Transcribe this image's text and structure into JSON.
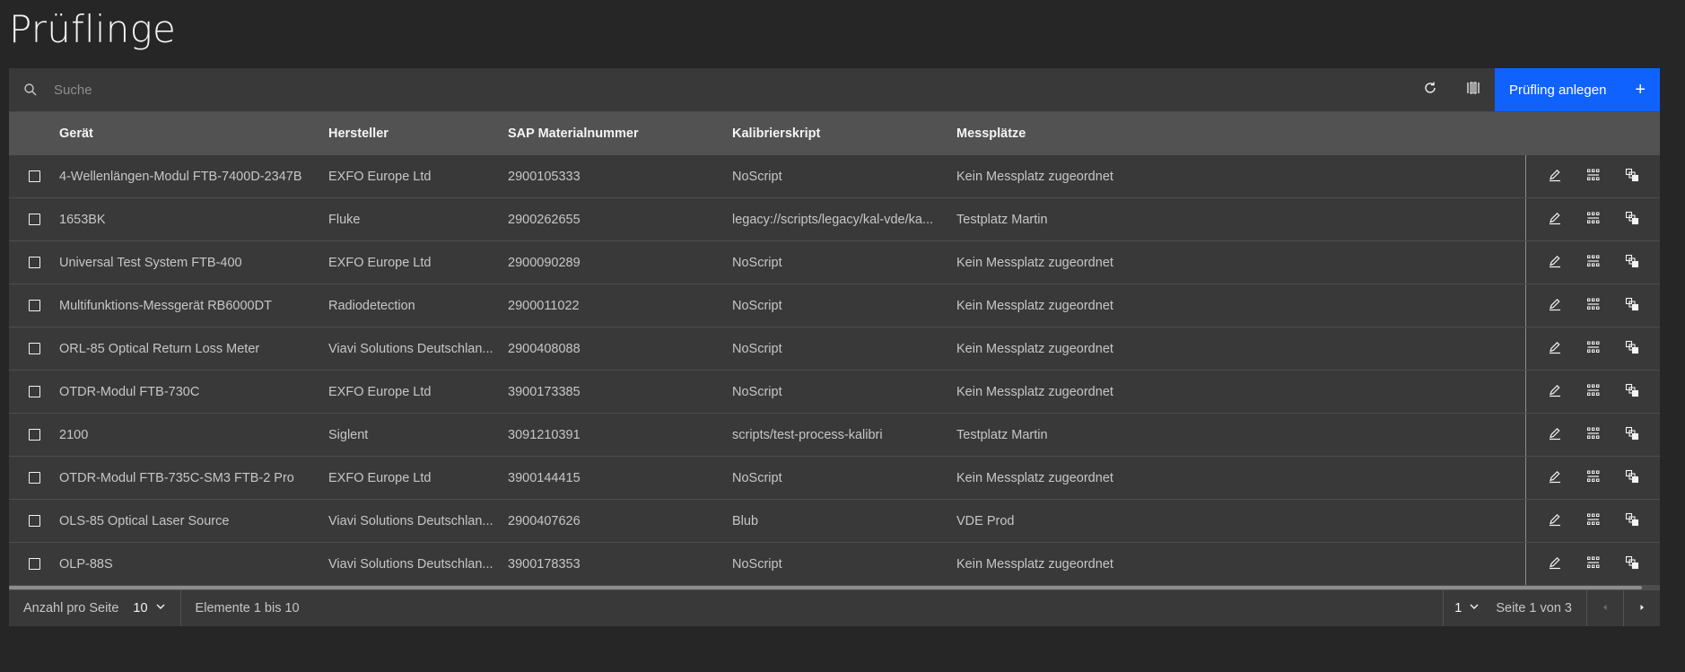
{
  "page": {
    "title": "Prüflinge"
  },
  "toolbar": {
    "search_placeholder": "Suche",
    "refresh_icon": "refresh-icon",
    "columns_icon": "column-settings-icon",
    "create_label": "Prüfling anlegen",
    "create_icon": "+"
  },
  "columns": {
    "geraet": "Gerät",
    "hersteller": "Hersteller",
    "sap": "SAP Materialnummer",
    "kalibrierskript": "Kalibrierskript",
    "messplaetze": "Messplätze"
  },
  "rows": [
    {
      "geraet": "4-Wellenlängen-Modul FTB-7400D-2347B",
      "hersteller": "EXFO Europe Ltd",
      "sap": "2900105333",
      "kalibrierskript": "NoScript",
      "messplaetze": "Kein Messplatz zugeordnet"
    },
    {
      "geraet": "1653BK",
      "hersteller": "Fluke",
      "sap": "2900262655",
      "kalibrierskript": "legacy://scripts/legacy/kal-vde/ka...",
      "messplaetze": "Testplatz Martin"
    },
    {
      "geraet": "Universal Test System FTB-400",
      "hersteller": "EXFO Europe Ltd",
      "sap": "2900090289",
      "kalibrierskript": "NoScript",
      "messplaetze": "Kein Messplatz zugeordnet"
    },
    {
      "geraet": "Multifunktions-Messgerät RB6000DT",
      "hersteller": "Radiodetection",
      "sap": "2900011022",
      "kalibrierskript": "NoScript",
      "messplaetze": "Kein Messplatz zugeordnet"
    },
    {
      "geraet": "ORL-85 Optical Return Loss Meter",
      "hersteller": "Viavi Solutions Deutschlan...",
      "sap": "2900408088",
      "kalibrierskript": "NoScript",
      "messplaetze": "Kein Messplatz zugeordnet"
    },
    {
      "geraet": "OTDR-Modul FTB-730C",
      "hersteller": "EXFO Europe Ltd",
      "sap": "3900173385",
      "kalibrierskript": "NoScript",
      "messplaetze": "Kein Messplatz zugeordnet"
    },
    {
      "geraet": "2100",
      "hersteller": "Siglent",
      "sap": "3091210391",
      "kalibrierskript": "scripts/test-process-kalibri",
      "messplaetze": "Testplatz Martin"
    },
    {
      "geraet": "OTDR-Modul FTB-735C-SM3 FTB-2 Pro",
      "hersteller": "EXFO Europe Ltd",
      "sap": "3900144415",
      "kalibrierskript": "NoScript",
      "messplaetze": "Kein Messplatz zugeordnet"
    },
    {
      "geraet": "OLS-85 Optical Laser Source",
      "hersteller": "Viavi Solutions Deutschlan...",
      "sap": "2900407626",
      "kalibrierskript": "Blub",
      "messplaetze": "VDE Prod"
    },
    {
      "geraet": "OLP-88S",
      "hersteller": "Viavi Solutions Deutschlan...",
      "sap": "3900178353",
      "kalibrierskript": "NoScript",
      "messplaetze": "Kein Messplatz zugeordnet"
    }
  ],
  "row_actions": [
    "edit-icon",
    "details-icon",
    "copy-icon"
  ],
  "pagination": {
    "per_page_label": "Anzahl pro Seite",
    "per_page_value": "10",
    "items_label": "Elemente 1 bis 10",
    "page_value": "1",
    "page_of_label": "Seite 1 von 3"
  },
  "colors": {
    "background": "#262626",
    "surface": "#393939",
    "header": "#525252",
    "primary": "#0f62fe"
  }
}
